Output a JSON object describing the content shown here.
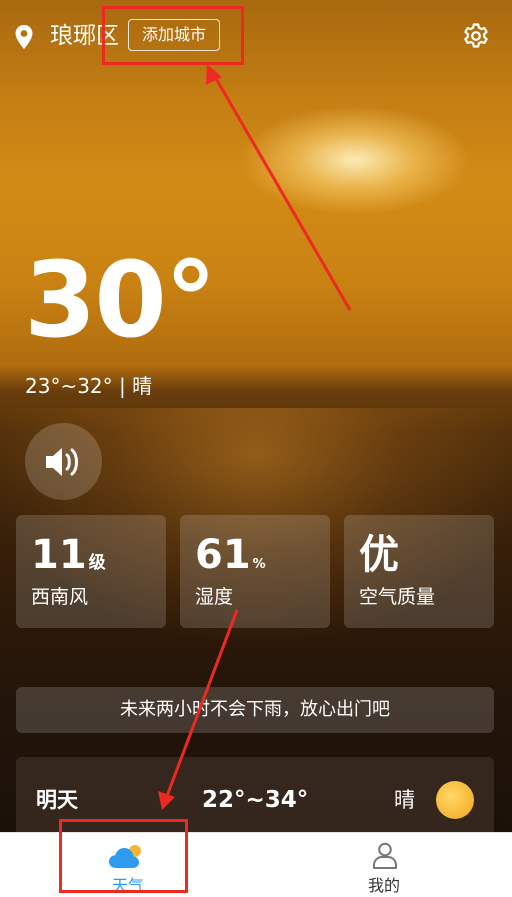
{
  "header": {
    "city": "琅琊区",
    "add_city_label": "添加城市",
    "location_icon": "map-pin-icon",
    "settings_icon": "gear-icon"
  },
  "current": {
    "temperature": "30°",
    "range_condition": "23°~32° | 晴"
  },
  "voice_button": {
    "icon": "speaker-icon"
  },
  "cards": [
    {
      "value": "11",
      "unit": "级",
      "label": "西南风"
    },
    {
      "value": "61",
      "unit": "%",
      "label": "湿度"
    },
    {
      "value": "优",
      "unit": "",
      "label": "空气质量"
    }
  ],
  "rain_tip": "未来两小时不会下雨，放心出门吧",
  "tomorrow": {
    "day": "明天",
    "range": "22°~34°",
    "condition": "晴",
    "icon": "sun-icon"
  },
  "tabs": [
    {
      "label": "天气",
      "icon": "cloud-sun-icon",
      "active": true
    },
    {
      "label": "我的",
      "icon": "person-icon",
      "active": false
    }
  ],
  "colors": {
    "active_tab": "#2f9bf0",
    "annotation": "#ec2a22",
    "sun": "#f5b531"
  }
}
